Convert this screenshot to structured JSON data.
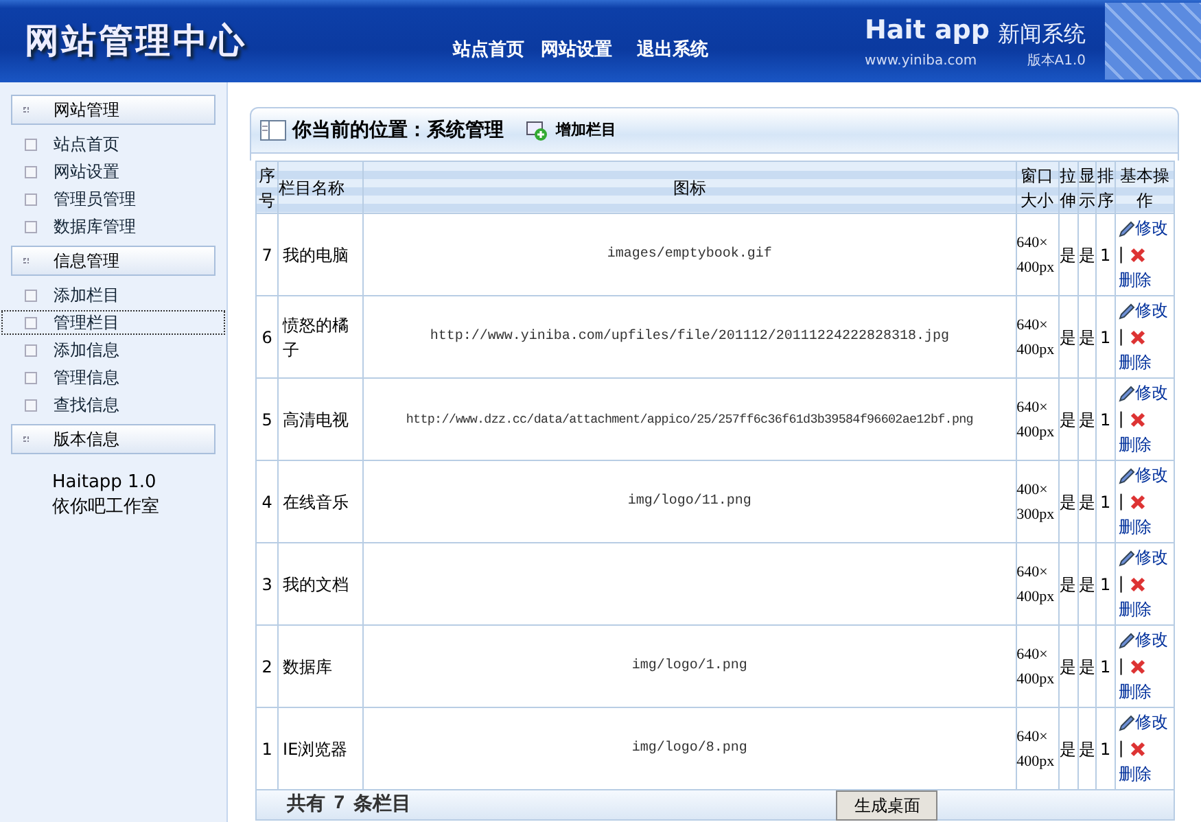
{
  "header": {
    "title": "网站管理中心",
    "nav": [
      "站点首页",
      "网站设置",
      "退出系统"
    ],
    "brand": "Hait app",
    "brand_sub": "新闻系统",
    "site": "www.yiniba.com",
    "version": "版本A1.0"
  },
  "sidebar": {
    "sections": [
      {
        "title": "网站管理",
        "items": [
          {
            "label": "站点首页",
            "selected": false
          },
          {
            "label": "网站设置",
            "selected": false
          },
          {
            "label": "管理员管理",
            "selected": false
          },
          {
            "label": "数据库管理",
            "selected": false
          }
        ]
      },
      {
        "title": "信息管理",
        "items": [
          {
            "label": "添加栏目",
            "selected": false
          },
          {
            "label": "管理栏目",
            "selected": true
          },
          {
            "label": "添加信息",
            "selected": false
          },
          {
            "label": "管理信息",
            "selected": false
          },
          {
            "label": "查找信息",
            "selected": false
          }
        ]
      },
      {
        "title": "版本信息",
        "lines": [
          "Haitapp 1.0",
          "依你吧工作室"
        ]
      }
    ]
  },
  "breadcrumb": "你当前的位置：系统管理",
  "add_button": "增加栏目",
  "table": {
    "columns": [
      "序号",
      "栏目名称",
      "图标",
      "窗口大小",
      "拉伸",
      "显示",
      "排序",
      "基本操作"
    ],
    "rows": [
      {
        "no": "7",
        "name": "我的电脑",
        "icon": "images/emptybook.gif",
        "size": "640×400px",
        "stretch": "是",
        "show": "是",
        "order": "1",
        "edit": "修改",
        "sep": "|",
        "delete": "删除"
      },
      {
        "no": "6",
        "name": "愤怒的橘子",
        "icon": "http://www.yiniba.com/upfiles/file/201112/20111224222828318.jpg",
        "size": "640×400px",
        "stretch": "是",
        "show": "是",
        "order": "1",
        "edit": "修改",
        "sep": "|",
        "delete": "删除"
      },
      {
        "no": "5",
        "name": "高清电视",
        "icon": "http://www.dzz.cc/data/attachment/appico/25/257ff6c36f61d3b39584f96602ae12bf.png",
        "size": "640×400px",
        "stretch": "是",
        "show": "是",
        "order": "1",
        "edit": "修改",
        "sep": "|",
        "delete": "删除"
      },
      {
        "no": "4",
        "name": "在线音乐",
        "icon": "img/logo/11.png",
        "size": "400×300px",
        "stretch": "是",
        "show": "是",
        "order": "1",
        "edit": "修改",
        "sep": "|",
        "delete": "删除"
      },
      {
        "no": "3",
        "name": "我的文档",
        "size": "640×400px",
        "stretch": "是",
        "show": "是",
        "order": "1",
        "edit": "修改",
        "sep": "|",
        "delete": "删除"
      },
      {
        "no": "2",
        "name": "数据库",
        "icon": "img/logo/1.png",
        "size": "640×400px",
        "stretch": "是",
        "show": "是",
        "order": "1",
        "edit": "修改",
        "sep": "|",
        "delete": "删除"
      },
      {
        "no": "1",
        "name": "IE浏览器",
        "icon": "img/logo/8.png",
        "size": "640×400px",
        "stretch": "是",
        "show": "是",
        "order": "1",
        "edit": "修改",
        "sep": "|",
        "delete": "删除"
      }
    ]
  },
  "footer": {
    "count_label": "共有",
    "count": "7",
    "count_unit": "条栏目",
    "button": "生成桌面"
  }
}
